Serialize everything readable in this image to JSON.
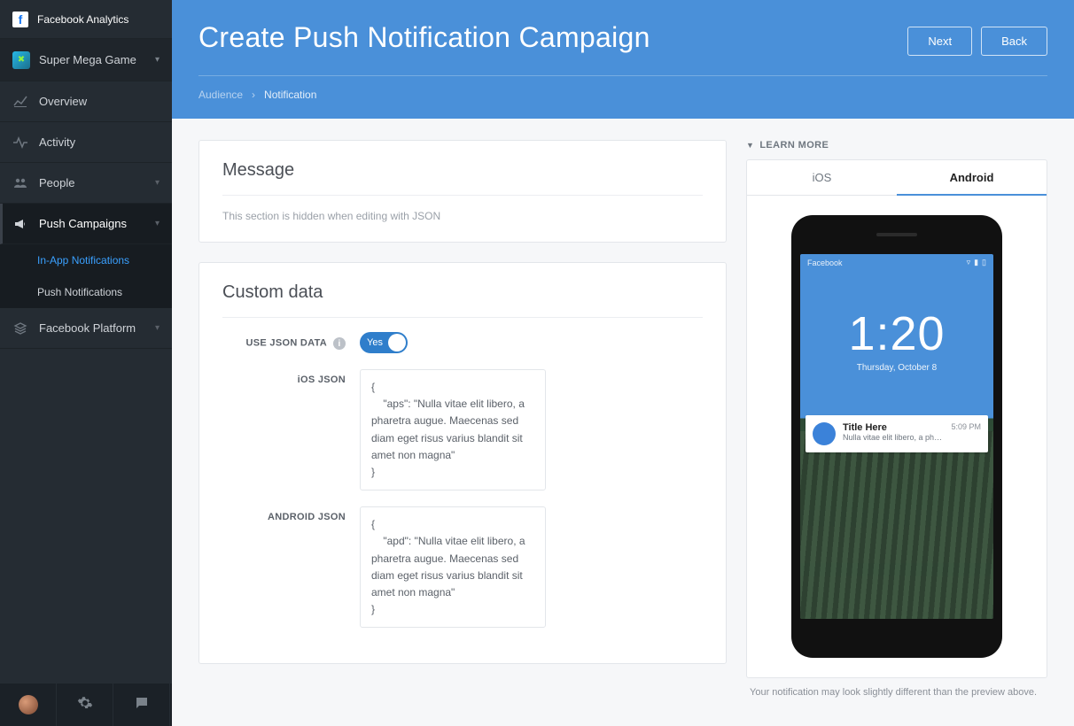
{
  "brand": {
    "name": "Facebook Analytics"
  },
  "app": {
    "name": "Super Mega Game"
  },
  "nav": {
    "overview": "Overview",
    "activity": "Activity",
    "people": "People",
    "push": "Push Campaigns",
    "push_sub": {
      "inapp": "In-App Notifications",
      "push": "Push Notifications"
    },
    "platform": "Facebook Platform"
  },
  "header": {
    "title": "Create Push Notification Campaign",
    "btn_next": "Next",
    "btn_back": "Back",
    "crumbs": {
      "a": "Audience",
      "sep": "›",
      "b": "Notification"
    }
  },
  "message": {
    "title": "Message",
    "hint": "This section is hidden when editing with JSON"
  },
  "custom": {
    "title": "Custom data",
    "use_json_label": "USE JSON DATA",
    "toggle_value": "Yes",
    "ios_label": "iOS JSON",
    "ios_value": "{\n    \"aps\": \"Nulla vitae elit libero, a pharetra augue. Maecenas sed diam eget risus varius blandit sit amet non magna\"\n}",
    "android_label": "ANDROID JSON",
    "android_value": "{\n    \"apd\": \"Nulla vitae elit libero, a pharetra augue. Maecenas sed diam eget risus varius blandit sit amet non magna\"\n}"
  },
  "preview": {
    "learn_more": "LEARN MORE",
    "tabs": {
      "ios": "iOS",
      "android": "Android"
    },
    "status_app": "Facebook",
    "time": "1:20",
    "date": "Thursday, October 8",
    "notif": {
      "title": "Title Here",
      "body": "Nulla vitae elit libero, a pharetra augue. Maecen...",
      "time": "5:09 PM"
    },
    "footnote": "Your notification may look slightly different than the preview above."
  }
}
